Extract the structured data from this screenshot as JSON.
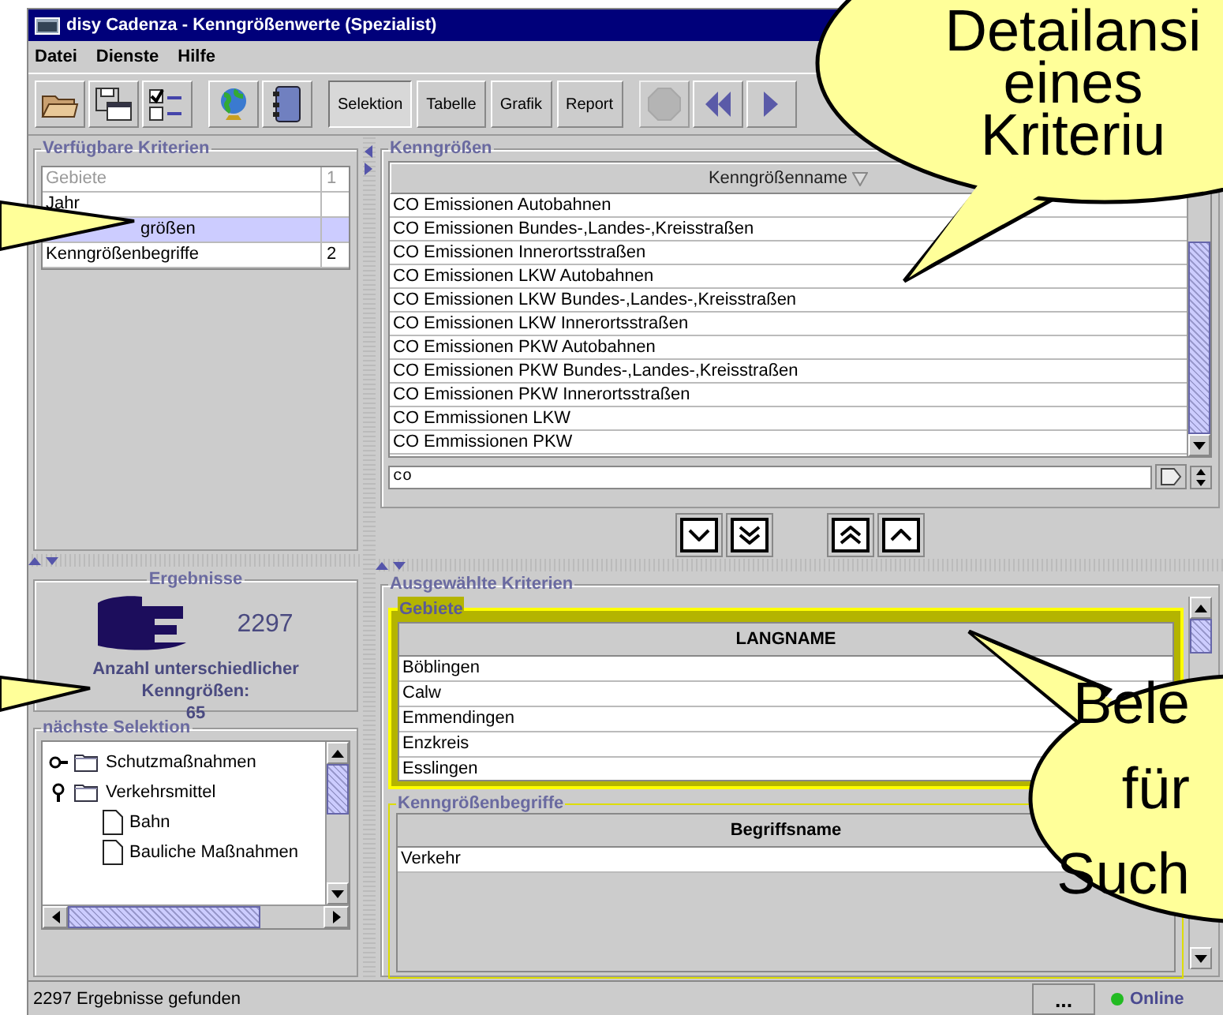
{
  "window": {
    "title": "disy Cadenza - Kenngrößenwerte (Spezialist)"
  },
  "menu": [
    {
      "label": "Datei"
    },
    {
      "label": "Dienste"
    },
    {
      "label": "Hilfe"
    }
  ],
  "toolbar_buttons": [
    {
      "label": "Selektion",
      "selected": true
    },
    {
      "label": "Tabelle",
      "selected": false
    },
    {
      "label": "Grafik",
      "selected": false
    },
    {
      "label": "Report",
      "selected": false
    }
  ],
  "available_criteria": {
    "title": "Verfügbare Kriterien",
    "rows": [
      {
        "name": "Gebiete",
        "count": "1",
        "disabled": true,
        "selected": false
      },
      {
        "name": "Jahr",
        "count": "",
        "disabled": false,
        "selected": false
      },
      {
        "name": "größen",
        "count": "",
        "disabled": false,
        "selected": true
      },
      {
        "name": "Kenngrößenbegriffe",
        "count": "2",
        "disabled": false,
        "selected": false
      }
    ]
  },
  "results": {
    "title": "Ergebnisse",
    "count": "2297",
    "label": "Anzahl unterschiedlicher Kenngrößen:",
    "value": "65"
  },
  "next_selection": {
    "title": "nächste Selektion",
    "items": [
      {
        "label": "Schutzmaßnahmen",
        "expanded": false
      },
      {
        "label": "Verkehrsmittel",
        "expanded": true,
        "children": [
          {
            "label": "Bahn"
          },
          {
            "label": "Bauliche Maßnahmen"
          }
        ]
      }
    ]
  },
  "kenngroessen": {
    "title": "Kenngrößen",
    "column": "Kenngrößenname",
    "rows": [
      "CO Emissionen Autobahnen",
      "CO Emissionen Bundes-,Landes-,Kreisstraßen",
      "CO Emissionen Innerortsstraßen",
      "CO Emissionen LKW Autobahnen",
      "CO Emissionen LKW Bundes-,Landes-,Kreisstraßen",
      "CO Emissionen LKW Innerortsstraßen",
      "CO Emissionen PKW Autobahnen",
      "CO Emissionen PKW Bundes-,Landes-,Kreisstraßen",
      "CO Emissionen PKW Innerortsstraßen",
      "CO Emmissionen LKW",
      "CO Emmissionen PKW"
    ],
    "search": "co"
  },
  "selected_criteria": {
    "title": "Ausgewählte Kriterien",
    "panels": [
      {
        "title": "Gebiete",
        "highlighted": true,
        "column": "LANGNAME",
        "rows": [
          "Böblingen",
          "Calw",
          "Emmendingen",
          "Enzkreis",
          "Esslingen"
        ]
      },
      {
        "title": "Kenngrößenbegriffe",
        "highlighted": false,
        "column": "Begriffsname",
        "rows": [
          "Verkehr"
        ]
      }
    ]
  },
  "status_bar": {
    "message": "2297 Ergebnisse gefunden",
    "button": "...",
    "connection": {
      "label": "Online",
      "online": true
    }
  },
  "callouts": [
    {
      "lines": [
        "Detailansi",
        "eines",
        "Kriteriu"
      ]
    },
    {
      "lines": [
        "Bele",
        "für",
        "Such"
      ]
    }
  ]
}
